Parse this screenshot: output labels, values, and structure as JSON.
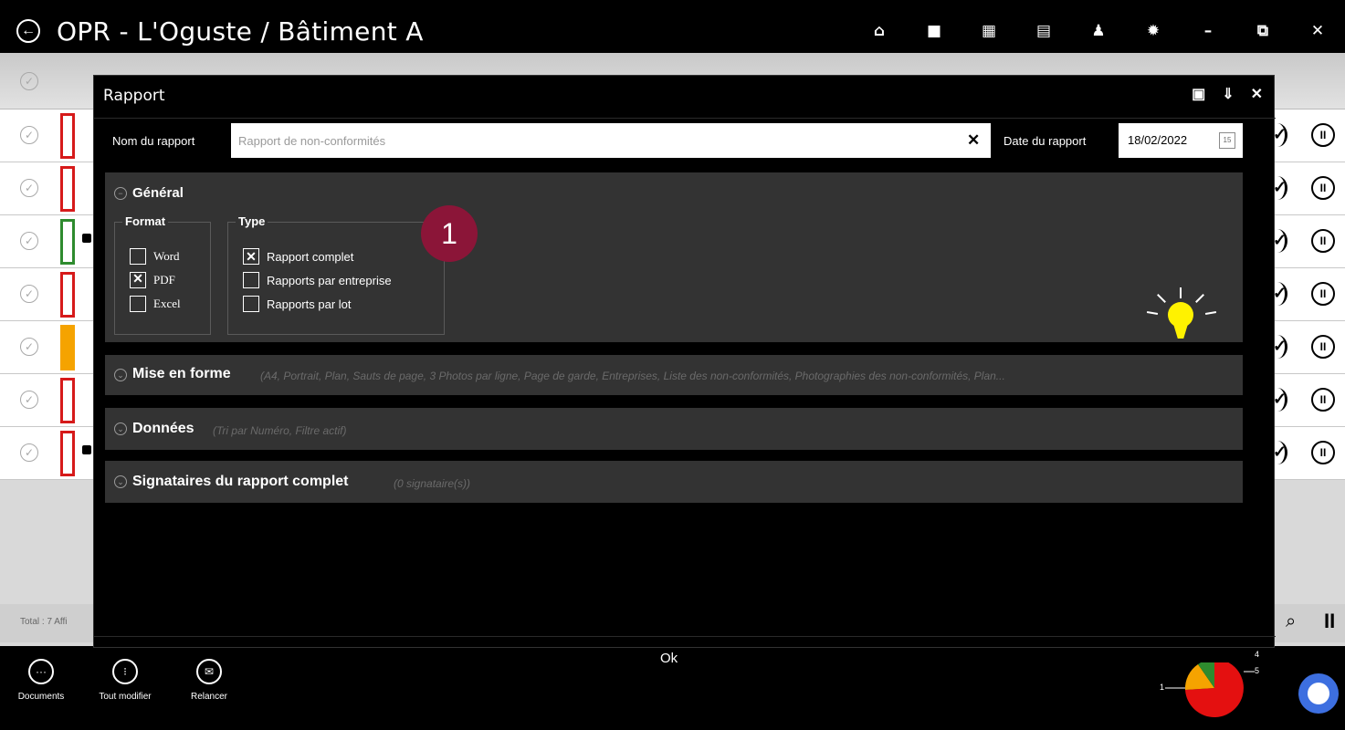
{
  "titlebar": {
    "title": "OPR - L'Oguste / Bâtiment A",
    "back_icon": "←",
    "icons": [
      "home-icon",
      "folder-icon",
      "grid-icon",
      "calendar-icon",
      "user-icon",
      "gear-icon",
      "minimize-icon",
      "restore-icon",
      "close-icon"
    ],
    "icon_glyphs": [
      "⌂",
      "■",
      "▦",
      "▤",
      "♟",
      "✹",
      "–",
      "⧉",
      "✕"
    ]
  },
  "background_list": {
    "rows": [
      {
        "mark": "red"
      },
      {
        "mark": "red"
      },
      {
        "mark": "green"
      },
      {
        "mark": "red"
      },
      {
        "mark": "orange"
      },
      {
        "mark": "red"
      },
      {
        "mark": "red"
      }
    ],
    "check_glyph": "✓",
    "pause_glyph": "II",
    "footer_total": "Total : 7   Affi",
    "search_glyph": "⌕",
    "pause_footer_glyph": "II"
  },
  "modal": {
    "title": "Rapport",
    "action_glyphs": [
      "▣",
      "⇓",
      "✕"
    ],
    "name_label": "Nom du rapport",
    "name_value": "",
    "name_placeholder": "Rapport de non-conformités",
    "clear_glyph": "✕",
    "date_label": "Date du rapport",
    "date_value": "18/02/2022",
    "calendar_glyph": "15",
    "sections": {
      "general": {
        "title": "Général",
        "toggle": "−",
        "format": {
          "legend": "Format",
          "options": [
            {
              "label": "Word",
              "checked": false
            },
            {
              "label": "PDF",
              "checked": true
            },
            {
              "label": "Excel",
              "checked": false
            }
          ]
        },
        "type": {
          "legend": "Type",
          "options": [
            {
              "label": "Rapport complet",
              "checked": true
            },
            {
              "label": "Rapports par entreprise",
              "checked": false
            },
            {
              "label": "Rapports par lot",
              "checked": false
            }
          ]
        },
        "badge": "1"
      },
      "mise_en_forme": {
        "title": "Mise en forme",
        "toggle": "⌄",
        "summary": "(A4, Portrait, Plan, Sauts de page, 3 Photos par ligne, Page de garde, Entreprises, Liste des non-conformités, Photographies des non-conformités, Plan..."
      },
      "donnees": {
        "title": "Données",
        "toggle": "⌄",
        "summary": "(Tri par Numéro, Filtre actif)"
      },
      "signataires": {
        "title": "Signataires du rapport complet",
        "toggle": "⌄",
        "summary": "(0 signataire(s))"
      }
    },
    "ok_label": "Ok"
  },
  "bottombar": {
    "items": [
      {
        "label": "Documents",
        "glyph": "···"
      },
      {
        "label": "Tout modifier",
        "glyph": "⁝"
      },
      {
        "label": "Relancer",
        "glyph": "✉"
      }
    ],
    "pie_labels": [
      "1",
      "5",
      "4"
    ]
  },
  "colors": {
    "title_bar": "#000000",
    "modal_bg": "#000000",
    "section_bg": "#333333",
    "badge": "#8b1538",
    "bulb": "#fff200",
    "mark_red": "#d61a1a",
    "mark_green": "#2e8b2e",
    "mark_orange": "#f5a300",
    "user_avatar": "#3d6fe0"
  }
}
